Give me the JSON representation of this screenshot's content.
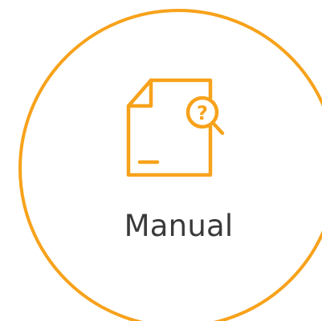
{
  "tile": {
    "label": "Manual",
    "icon": "document-search-icon",
    "accent_color": "#f7a21b",
    "text_color": "#3a3a3a"
  }
}
